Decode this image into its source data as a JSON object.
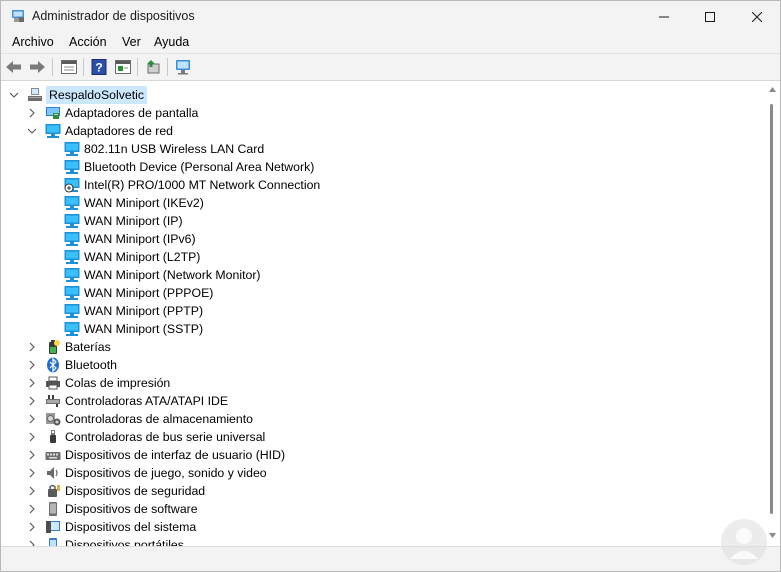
{
  "window": {
    "title": "Administrador de dispositivos",
    "icon": "device-manager-icon"
  },
  "menu": [
    "Archivo",
    "Acción",
    "Ver",
    "Ayuda"
  ],
  "toolbar": [
    "back-icon",
    "forward-icon",
    "properties-icon",
    "help-icon",
    "show-hidden-icon",
    "update-driver-icon",
    "scan-hardware-icon"
  ],
  "tree": {
    "root": "RespaldoSolvetic",
    "items": [
      {
        "label": "Adaptadores de pantalla",
        "icon": "display-adapter-icon"
      },
      {
        "label": "Adaptadores de red",
        "icon": "network-adapter-icon",
        "expanded": true,
        "children": [
          "802.11n USB Wireless LAN Card",
          "Bluetooth Device (Personal Area Network)",
          "Intel(R) PRO/1000 MT Network Connection",
          "WAN Miniport (IKEv2)",
          "WAN Miniport (IP)",
          "WAN Miniport (IPv6)",
          "WAN Miniport (L2TP)",
          "WAN Miniport (Network Monitor)",
          "WAN Miniport (PPPOE)",
          "WAN Miniport (PPTP)",
          "WAN Miniport (SSTP)"
        ]
      },
      {
        "label": "Baterías",
        "icon": "battery-icon"
      },
      {
        "label": "Bluetooth",
        "icon": "bluetooth-icon"
      },
      {
        "label": "Colas de impresión",
        "icon": "printer-icon"
      },
      {
        "label": "Controladoras ATA/ATAPI IDE",
        "icon": "ide-controller-icon"
      },
      {
        "label": "Controladoras de almacenamiento",
        "icon": "storage-controller-icon"
      },
      {
        "label": "Controladoras de bus serie universal",
        "icon": "usb-icon"
      },
      {
        "label": "Dispositivos de interfaz de usuario (HID)",
        "icon": "hid-icon"
      },
      {
        "label": "Dispositivos de juego, sonido y video",
        "icon": "speaker-icon"
      },
      {
        "label": "Dispositivos de seguridad",
        "icon": "security-device-icon"
      },
      {
        "label": "Dispositivos de software",
        "icon": "software-device-icon"
      },
      {
        "label": "Dispositivos del sistema",
        "icon": "system-device-icon"
      },
      {
        "label": "Dispositivos portátiles",
        "icon": "portable-device-icon"
      }
    ]
  },
  "colors": {
    "selection": "#cce8ff",
    "network_icon": "#1e90d6",
    "chrome": "#f3f3f3"
  }
}
